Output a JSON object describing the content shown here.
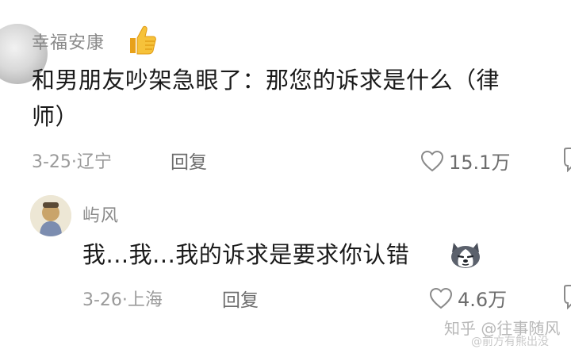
{
  "comments": [
    {
      "username": "幸福安康",
      "username_icon": "thumbs-up-icon",
      "text_lines": [
        "和男朋友吵架急眼了：那您的诉求是什么（律",
        "师）"
      ],
      "meta": "3-25·辽宁",
      "reply_label": "回复",
      "likes": "15.1万"
    },
    {
      "username": "屿风",
      "text": "我...我...我的诉求是要求你认错",
      "text_icon": "husky-emoji-icon",
      "meta": "3-26·上海",
      "reply_label": "回复",
      "likes": "4.6万"
    }
  ],
  "watermark": {
    "main": "知乎 @往事随风",
    "sub": "@前方有熊出没"
  },
  "colors": {
    "text": "#1a1a1a",
    "username": "#8a8a8a",
    "meta": "#9a9a9a",
    "background": "#ffffff"
  }
}
